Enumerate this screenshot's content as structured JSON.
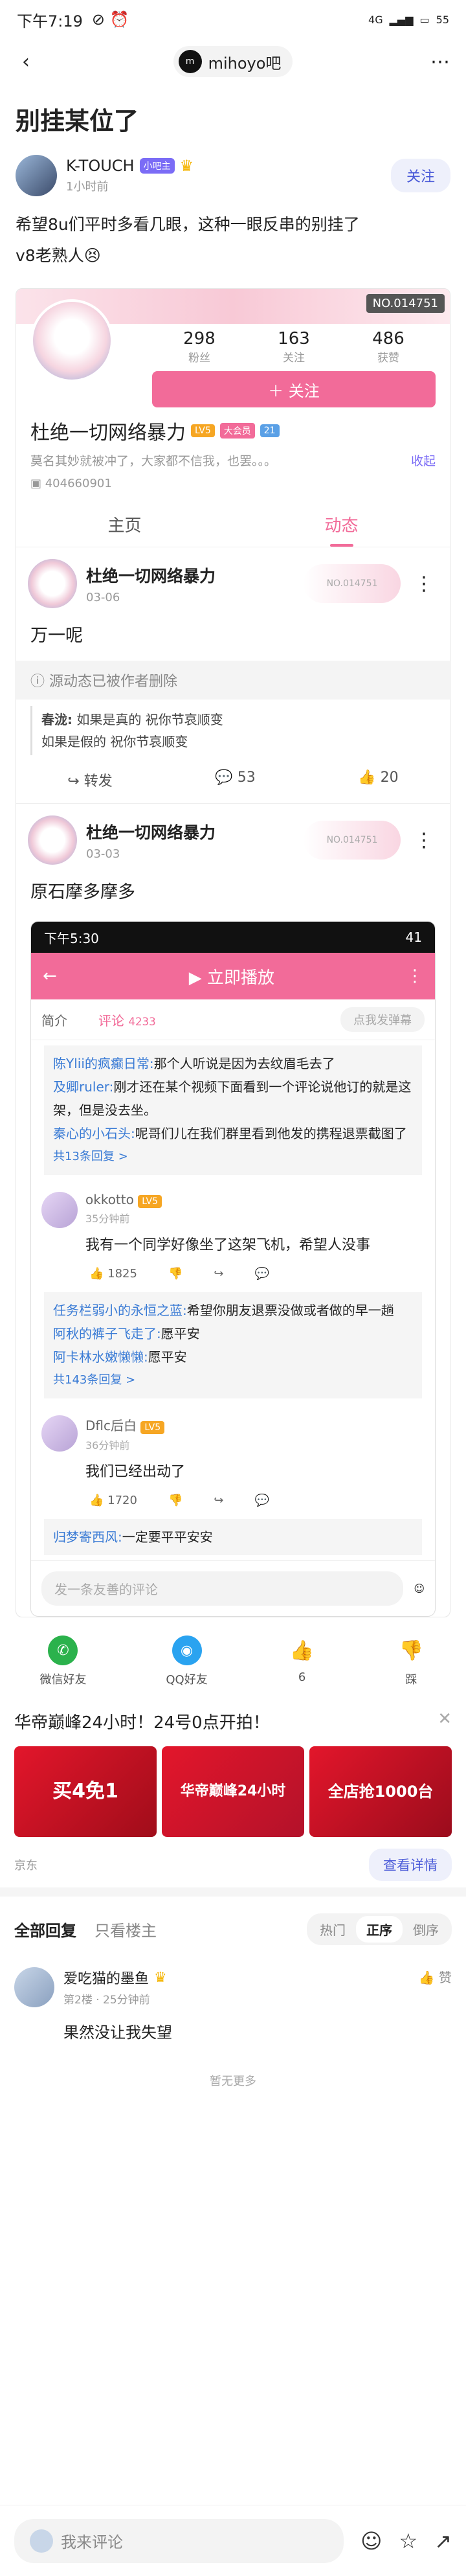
{
  "status": {
    "time": "下午7:19",
    "battery": "55",
    "network": "4G"
  },
  "topbar": {
    "forum": "mihoyo吧"
  },
  "post": {
    "title": "别挂某位了",
    "author": "K-TOUCH",
    "author_badge": "小吧主",
    "time": "1小时前",
    "follow": "关注",
    "text1": "希望8u们平时多看几眼，这种一眼反串的别挂了",
    "text2": "v8老熟人😣"
  },
  "profile": {
    "banner_tag": "NO.014751",
    "fans": "298",
    "fans_label": "粉丝",
    "follows": "163",
    "follows_label": "关注",
    "likes": "486",
    "likes_label": "获赞",
    "follow": "＋ 关注",
    "name": "杜绝一切网络暴力",
    "lv": "LV5",
    "member": "大会员",
    "level": "21",
    "bio": "莫名其妙就被冲了，大家都不信我，也罢。。。",
    "collapse": "收起",
    "uid": "404660901",
    "tab_home": "主页",
    "tab_dynamic": "动态"
  },
  "feed1": {
    "name": "杜绝一切网络暴力",
    "date": "03-06",
    "text": "万一呢",
    "deleted": "源动态已被作者删除",
    "quote_user": "春泷:",
    "quote1": "如果是真的 祝你节哀顺变",
    "quote2": "如果是假的 祝你节哀顺变",
    "share": "转发",
    "comments": "53",
    "likes": "20"
  },
  "feed2": {
    "name": "杜绝一切网络暴力",
    "date": "03-03",
    "text": "原石摩多摩多"
  },
  "phone": {
    "time": "下午5:30",
    "signal": "41",
    "play": "立即播放",
    "tab_intro": "简介",
    "tab_comment": "评论",
    "comment_count": "4233",
    "danmu": "点我发弹幕",
    "r1_user": "陈Ylii的疯癫日常:",
    "r1_text": "那个人听说是因为去纹眉毛去了",
    "r2_user": "及卿ruler:",
    "r2_text": "刚才还在某个视频下面看到一个评论说他订的就是这架，但是没去坐。",
    "r3_user": "秦心的小石头:",
    "r3_text": "呢哥们儿在我们群里看到他发的携程退票截图了",
    "r_more": "共13条回复 >",
    "c1_name": "okkotto",
    "c1_lv": "LV5",
    "c1_time": "35分钟前",
    "c1_text": "我有一个同学好像坐了这架飞机，希望人没事",
    "c1_likes": "1825",
    "s1_user": "任务栏弱小的永恒之蓝:",
    "s1_text": "希望你朋友退票没做或者做的早一趟",
    "s2_user": "阿秋的裤子飞走了:",
    "s2_text": "愿平安",
    "s3_user": "阿卡林水嫩懒懒:",
    "s3_text": "愿平安",
    "s_more": "共143条回复 >",
    "c2_name": "Dflc后白",
    "c2_lv": "LV5",
    "c2_time": "36分钟前",
    "c2_text": "我们已经出动了",
    "c2_likes": "1720",
    "s4_user": "归梦寄西风:",
    "s4_text": "一定要平平安安",
    "input": "发一条友善的评论"
  },
  "share": {
    "wechat": "微信好友",
    "qq": "QQ好友",
    "like": "6",
    "dislike": "踩"
  },
  "ad": {
    "title": "华帝巅峰24小时！24号0点开拍！",
    "img1": "买4免1",
    "img2": "华帝巅峰24小时",
    "img3": "全店抢1000台",
    "source": "京东",
    "cta": "查看详情"
  },
  "replies": {
    "all": "全部回复",
    "owner": "只看楼主",
    "hot": "热门",
    "asc": "正序",
    "desc": "倒序"
  },
  "floor": {
    "name": "爱吃猫的墨鱼",
    "meta": "第2楼 · 25分钟前",
    "text": "果然没让我失望",
    "like": "赞"
  },
  "nomore": "暂无更多",
  "bottom": {
    "placeholder": "我来评论"
  }
}
